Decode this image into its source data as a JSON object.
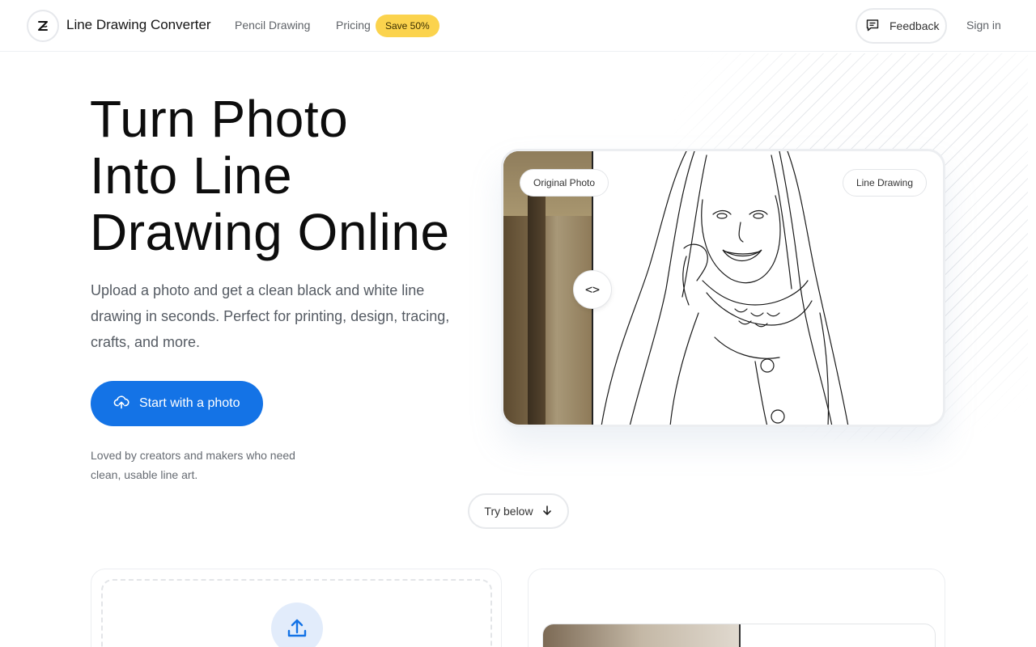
{
  "header": {
    "brand": "Line Drawing Converter",
    "nav": [
      {
        "label": "Pencil Drawing"
      },
      {
        "label": "Pricing"
      }
    ],
    "badge": "Save 50%",
    "feedback_label": "Feedback",
    "signin_label": "Sign in"
  },
  "hero": {
    "title_lines": [
      "Turn Photo",
      "Into Line",
      "Drawing Online"
    ],
    "subtitle": "Upload a photo and get a clean black and white line drawing in seconds. Perfect for printing, design, tracing, crafts, and more.",
    "cta_label": "Start with a photo",
    "loved_text": "Loved by creators and makers who need clean, usable line art.",
    "try_below_label": "Try below"
  },
  "compare": {
    "left_label": "Original Photo",
    "right_label": "Line Drawing",
    "handle_glyph": "<>"
  },
  "icons": {
    "logo": "logo-icon",
    "feedback": "message-icon",
    "cta": "cloud-upload-icon",
    "try_below": "arrow-down-icon",
    "upload": "upload-icon"
  },
  "colors": {
    "accent": "#1473e6",
    "badge": "#fbd34d",
    "upload_circle": "#e2ecfb"
  }
}
